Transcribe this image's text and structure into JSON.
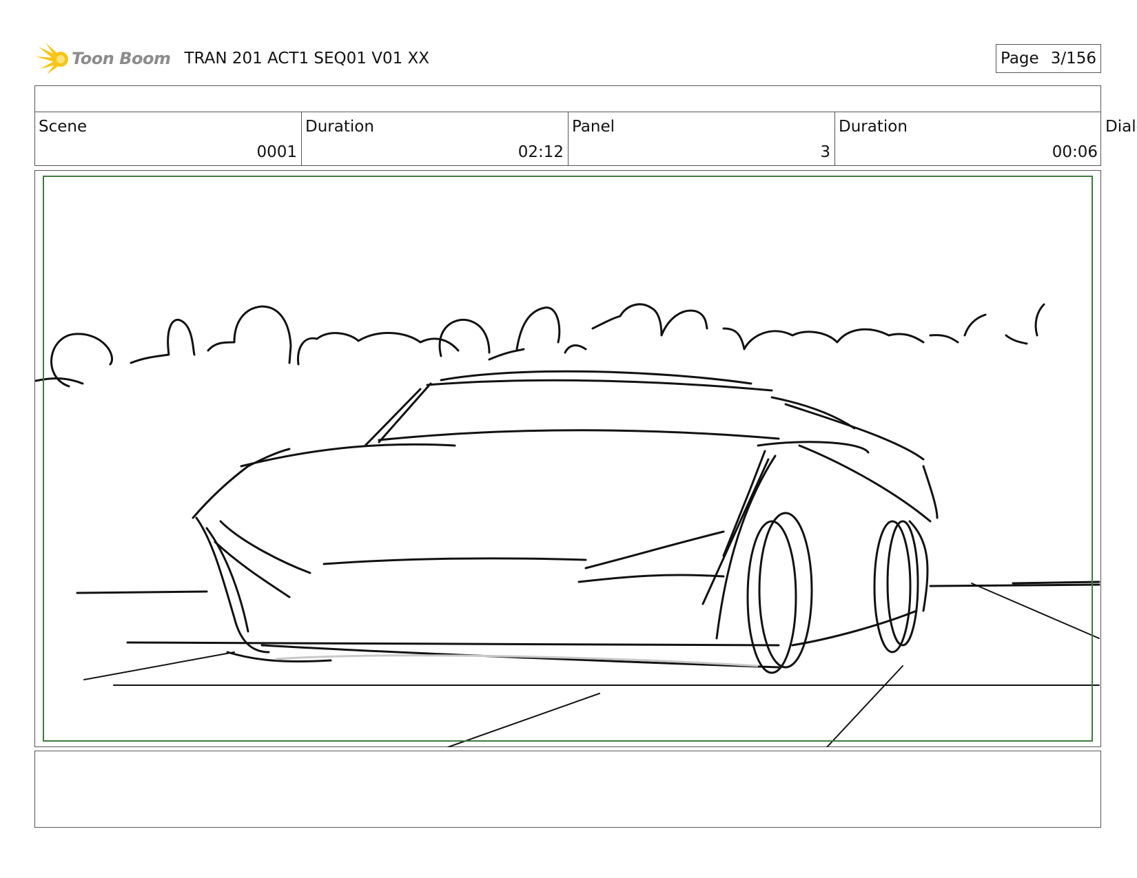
{
  "header": {
    "brand_name": "Toon Boom",
    "project_title": "TRAN 201 ACT1 SEQ01 V01 XX",
    "page_label": "Page",
    "page_number": "3/156"
  },
  "info": {
    "scene_label": "Scene",
    "scene_value": "0001",
    "scene_duration_label": "Duration",
    "scene_duration_value": "02:12",
    "panel_label": "Panel",
    "panel_value": "3",
    "panel_duration_label": "Duration",
    "panel_duration_value": "00:06",
    "dialog_label": "Dialo"
  },
  "panel": {
    "frame_color": "#3d7a3d",
    "sketch_subject": "car-sketch"
  },
  "colors": {
    "logo_yellow": "#f5c518",
    "brand_gray": "#8c8c8c"
  }
}
